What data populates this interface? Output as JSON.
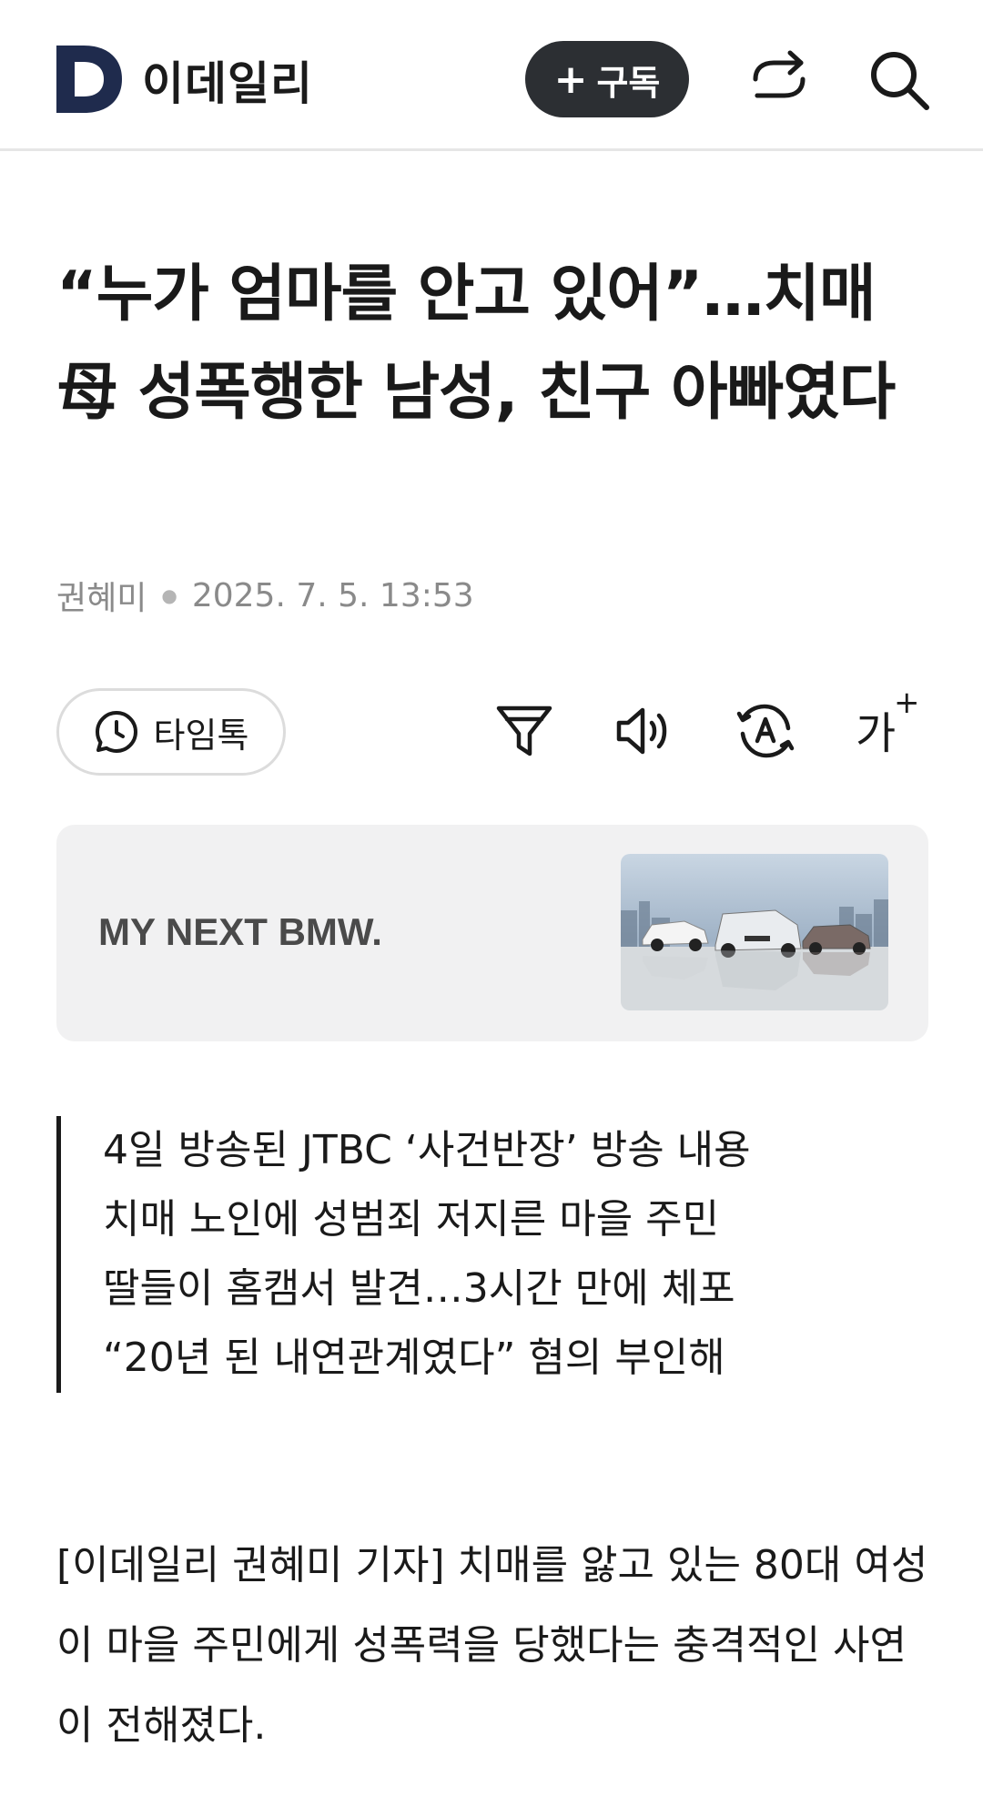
{
  "header": {
    "logo_letter": "D",
    "logo_text": "이데일리",
    "subscribe_label": "구독",
    "subscribe_plus": "+"
  },
  "article": {
    "headline": "“누가 엄마를 안고 있어”…치매 母 성폭행한 남성, 친구 아빠였다",
    "author": "권혜미",
    "date": "2025. 7. 5. 13:53",
    "timetalk_label": "타임톡",
    "font_size_label": "가",
    "font_size_sup": "+",
    "summary": [
      "4일 방송된 JTBC ‘사건반장’ 방송 내용",
      "치매 노인에 성범죄 저지른 마을 주민",
      "딸들이 홈캠서 발견…3시간 만에 체포",
      "“20년 된 내연관계였다” 혐의 부인해"
    ],
    "body": "[이데일리 권혜미 기자] 치매를 앓고 있는 80대 여성이 마을 주민에게 성폭력을 당했다는 충격적인 사연이 전해졌다."
  },
  "ad": {
    "text": "MY NEXT BMW."
  },
  "icons": {
    "logo": "logo-d-icon",
    "share": "share-icon",
    "search": "search-icon",
    "timetalk": "clock-chat-icon",
    "filter": "filter-icon",
    "speaker": "speaker-icon",
    "translate": "translate-a-icon"
  },
  "colors": {
    "logo_navy": "#1f2b4d",
    "subscribe_bg": "#2c2f33",
    "ad_bg": "#f1f1f2"
  }
}
